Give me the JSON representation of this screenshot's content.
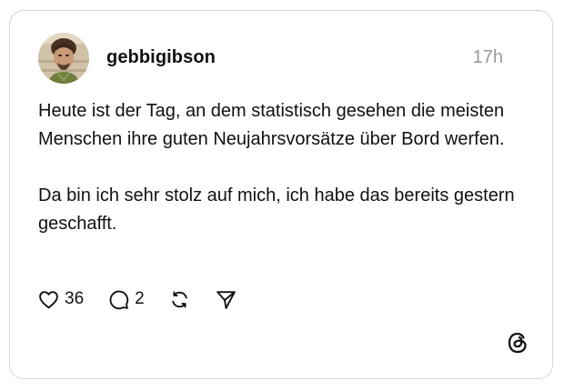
{
  "post": {
    "username": "gebbigibson",
    "timestamp": "17h",
    "paragraphs": [
      "Heute ist der Tag, an dem statistisch gesehen die meisten Menschen ihre guten Neujahrsvorsätze über Bord werfen.",
      "Da bin ich sehr stolz auf mich, ich habe das bereits gestern geschafft."
    ],
    "likes": "36",
    "replies": "2"
  },
  "icons": {
    "like": "heart-icon",
    "reply": "speech-bubble-icon",
    "repost": "repost-icon",
    "share": "send-icon",
    "logo": "threads-logo-icon"
  },
  "colors": {
    "text": "#111111",
    "timestamp": "#999999",
    "border": "#d6d6d6"
  }
}
